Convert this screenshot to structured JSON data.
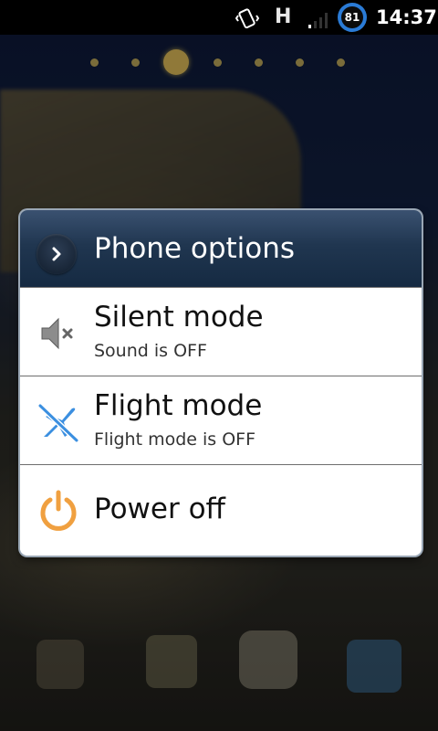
{
  "status_bar": {
    "network": "H",
    "battery": "81",
    "time": "14:37",
    "icons": [
      "vibrate-icon",
      "network-h-icon",
      "signal-icon",
      "battery-icon"
    ]
  },
  "dialog": {
    "title": "Phone options",
    "items": [
      {
        "label": "Silent mode",
        "subtitle": "Sound is OFF",
        "icon": "speaker-muted-icon"
      },
      {
        "label": "Flight mode",
        "subtitle": "Flight mode is OFF",
        "icon": "airplane-off-icon"
      },
      {
        "label": "Power off",
        "icon": "power-icon"
      }
    ]
  },
  "colors": {
    "header": "#203650",
    "power_accent": "#f0a040",
    "flight_accent": "#3b8fe0",
    "battery_ring": "#2a7bd6"
  }
}
